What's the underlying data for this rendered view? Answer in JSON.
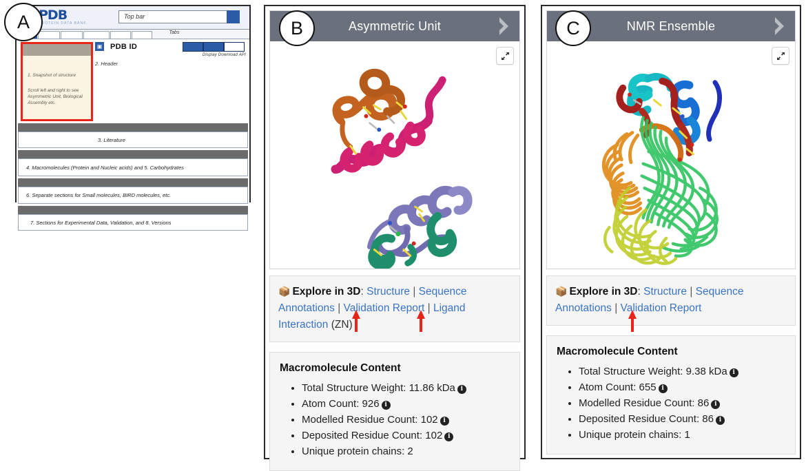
{
  "callouts": [
    {
      "id": "a",
      "label": "A"
    },
    {
      "id": "b",
      "label": "B"
    },
    {
      "id": "c",
      "label": "C"
    }
  ],
  "wireframe": {
    "logo_main": "PDB",
    "logo_sub": "PROTEIN DATA BANK",
    "search_placeholder": "Top bar",
    "tabs_label": "Tabs",
    "snapshot_title": "1. Snapshot of structure",
    "snapshot_hint": "Scroll left and right to see Asymmetric Unit, Biological Assembly etc.",
    "pdb_icon": "pdb-badge-icon",
    "pdb_id": "PDB ID",
    "header_label": "2. Header",
    "action_labels": "Display  Download  API",
    "actions": [
      "Display",
      "Download",
      "API"
    ],
    "sections": [
      {
        "label": "3. Literature"
      },
      {
        "label": "4. Macromolecules (Protein and Nucleic acids) and 5. Carbohydrates"
      },
      {
        "label": "6. Separate sections for Small molecules, BIRD molecules, etc."
      },
      {
        "label": "7. Sections for Experimental Data, Validation, and 8. Versions"
      }
    ]
  },
  "panels": [
    {
      "id": "b",
      "viewer_title": "Asymmetric Unit",
      "prev_icon": "chevron-left-icon",
      "next_icon": "chevron-right-icon",
      "expand_icon": "expand-diagonal-icon",
      "structure_alt": "asymmetric-unit-cartoon",
      "explore": {
        "cube_icon": "cube-3d-icon",
        "label": "Explore in 3D",
        "colon": ":",
        "links": [
          "Structure",
          "Sequence Annotations",
          "Validation Report",
          "Ligand Interaction"
        ],
        "ligand": "(ZN)"
      },
      "arrows": [
        "Validation Report",
        "Ligand Interaction"
      ],
      "macromolecule": {
        "title": "Macromolecule Content",
        "items": [
          {
            "text": "Total Structure Weight: 11.86 kDa",
            "info": true
          },
          {
            "text": "Atom Count: 926",
            "info": true
          },
          {
            "text": "Modelled Residue Count: 102",
            "info": true
          },
          {
            "text": "Deposited Residue Count: 102",
            "info": true
          },
          {
            "text": "Unique protein chains: 2",
            "info": false
          }
        ]
      }
    },
    {
      "id": "c",
      "viewer_title": "NMR Ensemble",
      "prev_icon": "chevron-left-icon",
      "next_icon": "chevron-right-icon",
      "expand_icon": "expand-diagonal-icon",
      "structure_alt": "nmr-ensemble-cartoon",
      "explore": {
        "cube_icon": "cube-3d-icon",
        "label": "Explore in 3D",
        "colon": ":",
        "links": [
          "Structure",
          "Sequence Annotations",
          "Validation Report"
        ],
        "ligand": ""
      },
      "arrows": [
        "Validation Report"
      ],
      "macromolecule": {
        "title": "Macromolecule Content",
        "items": [
          {
            "text": "Total Structure Weight: 9.38 kDa",
            "info": true
          },
          {
            "text": "Atom Count: 655",
            "info": true
          },
          {
            "text": "Modelled Residue Count: 86",
            "info": true
          },
          {
            "text": "Deposited Residue Count: 86",
            "info": true
          },
          {
            "text": "Unique protein chains: 1",
            "info": false
          }
        ]
      }
    }
  ],
  "colors": {
    "accent_blue": "#3b73c4",
    "header_gray": "#6a707c",
    "arrow_red": "#e8241b",
    "pdb_blue": "#2b5ca5",
    "panel_bg": "#f5f5f5"
  }
}
